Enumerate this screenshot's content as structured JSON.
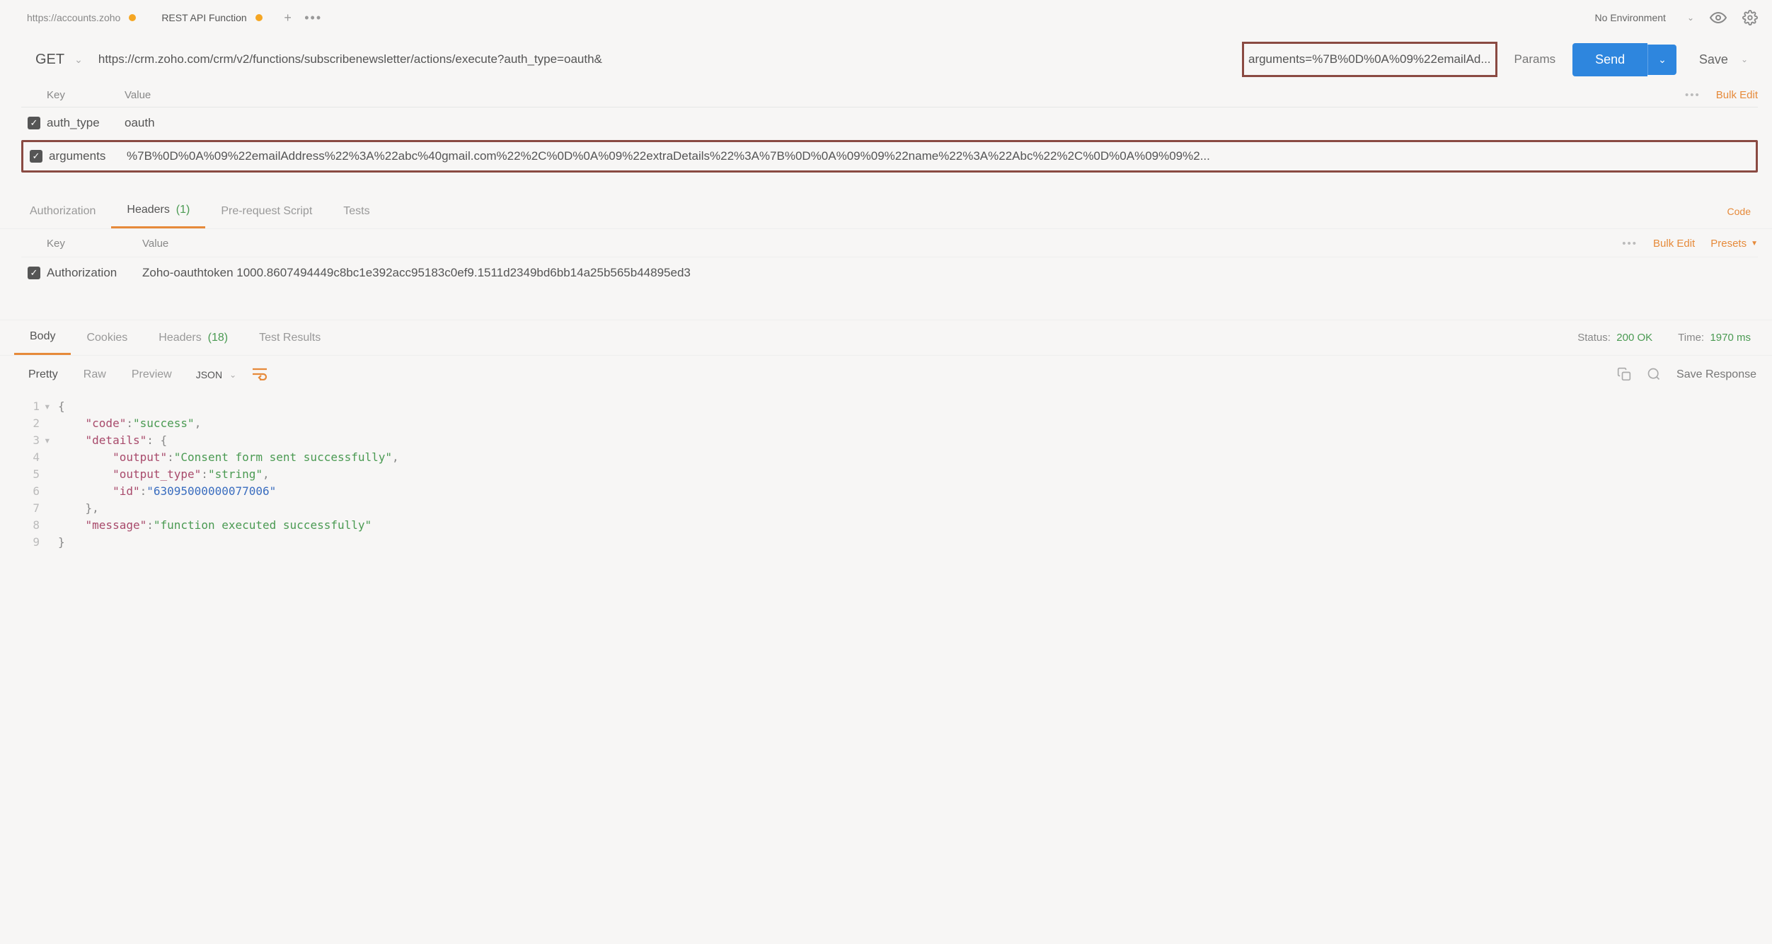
{
  "tabs": [
    {
      "label": "https://accounts.zoho",
      "active": false
    },
    {
      "label": "REST API Function",
      "active": true
    }
  ],
  "environment": "No Environment",
  "request": {
    "method": "GET",
    "url_prefix": "https://crm.zoho.com/crm/v2/functions/subscribenewsletter/actions/execute?auth_type=oauth&",
    "url_highlight": "arguments=%7B%0D%0A%09%22emailAd...",
    "params_btn": "Params",
    "send": "Send",
    "save": "Save"
  },
  "params_header": {
    "key": "Key",
    "value": "Value",
    "bulk": "Bulk Edit"
  },
  "params": [
    {
      "key": "auth_type",
      "value": "oauth"
    },
    {
      "key": "arguments",
      "value": "%7B%0D%0A%09%22emailAddress%22%3A%22abc%40gmail.com%22%2C%0D%0A%09%22extraDetails%22%3A%7B%0D%0A%09%09%22name%22%3A%22Abc%22%2C%0D%0A%09%09%2..."
    }
  ],
  "req_tabs": {
    "authorization": "Authorization",
    "headers": "Headers",
    "headers_count": "(1)",
    "prerequest": "Pre-request Script",
    "tests": "Tests",
    "code": "Code"
  },
  "headers_header": {
    "key": "Key",
    "value": "Value",
    "bulk": "Bulk Edit",
    "presets": "Presets"
  },
  "headers": [
    {
      "key": "Authorization",
      "value": "Zoho-oauthtoken 1000.8607494449c8bc1e392acc95183c0ef9.1511d2349bd6bb14a25b565b44895ed3"
    }
  ],
  "resp_tabs": {
    "body": "Body",
    "cookies": "Cookies",
    "headers": "Headers",
    "headers_count": "(18)",
    "testresults": "Test Results"
  },
  "status": {
    "label": "Status:",
    "value": "200 OK"
  },
  "time": {
    "label": "Time:",
    "value": "1970 ms"
  },
  "body_toolbar": {
    "pretty": "Pretty",
    "raw": "Raw",
    "preview": "Preview",
    "format": "JSON",
    "save_response": "Save Response"
  },
  "response_body": {
    "code": "success",
    "details": {
      "output": "Consent form sent successfully",
      "output_type": "string",
      "id": "63095000000077006"
    },
    "message": "function executed successfully"
  }
}
